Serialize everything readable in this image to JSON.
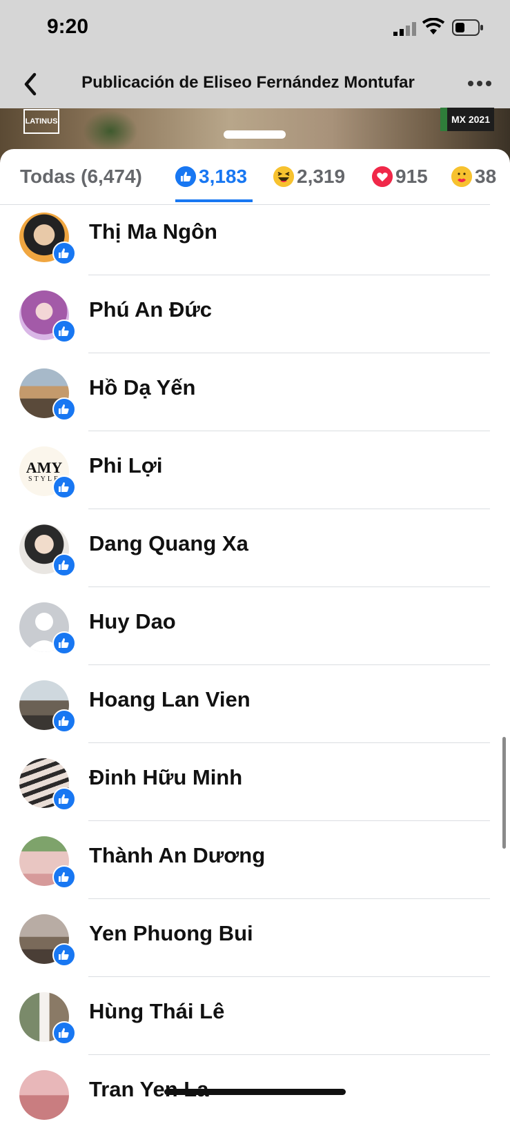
{
  "status_bar": {
    "time": "9:20"
  },
  "nav": {
    "title": "Publicación de Eliseo Fernández Montufar"
  },
  "post_logos": {
    "left": "LATINUS",
    "right": "MX 2021"
  },
  "tabs": {
    "all_label": "Todas (6,474)",
    "like_count": "3,183",
    "haha_count": "2,319",
    "love_count": "915",
    "care_count": "38"
  },
  "users": [
    {
      "name": "Thị Ma Ngôn"
    },
    {
      "name": "Phú An Đức"
    },
    {
      "name": "Hồ Dạ Yến"
    },
    {
      "name": "Phi Lợi"
    },
    {
      "name": "Dang Quang Xa"
    },
    {
      "name": "Huy Dao"
    },
    {
      "name": "Hoang Lan Vien"
    },
    {
      "name": "Đinh Hữu Minh"
    },
    {
      "name": "Thành An Dương"
    },
    {
      "name": "Yen Phuong Bui"
    },
    {
      "name": "Hùng Thái Lê"
    },
    {
      "name": "Tran Yen La"
    }
  ],
  "avatar_logo_text": {
    "line1": "AMY",
    "line2": "STYLE"
  },
  "colors": {
    "accent": "#1877f2",
    "text": "#111111",
    "secondary": "#65676b"
  }
}
